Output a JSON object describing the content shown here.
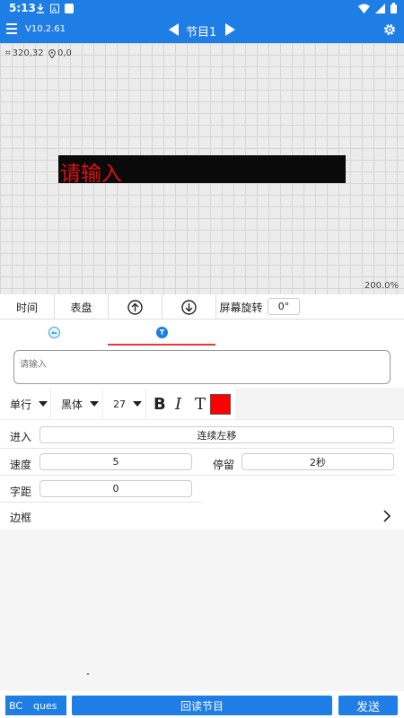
{
  "status_bar": {
    "time": "5:13",
    "icons": [
      "download-icon",
      "notification-icon",
      "app-icon",
      "wifi-icon",
      "signal-icon",
      "battery-icon"
    ]
  },
  "app_bar": {
    "version": "V10.2.61",
    "program": "节目1"
  },
  "canvas": {
    "size_readout": "320,32",
    "position_readout": "0,0",
    "led_text": "请输入",
    "zoom": "200.0%"
  },
  "tools": {
    "time": "时间",
    "dial": "表盘",
    "rotation_label": "屏幕旋转",
    "rotation_value": "0°"
  },
  "text_input": {
    "placeholder": "请输入"
  },
  "font_row": {
    "line_mode": "单行",
    "font": "黑体",
    "size": "27",
    "bold": "B",
    "italic": "I",
    "text_tool": "T",
    "text_color": "#ff0000"
  },
  "form": {
    "enter_label": "进入",
    "enter_value": "连续左移",
    "speed_label": "速度",
    "speed_value": "5",
    "stay_label": "停留",
    "stay_value": "2秒",
    "spacing_label": "字距",
    "spacing_value": "0",
    "border_label": "边框"
  },
  "bottom": {
    "field_left": "BC",
    "field_right": "ques",
    "readback": "回读节目",
    "send": "发送"
  },
  "colors": {
    "accent": "#1f7de6",
    "tab_indicator": "#e03a3a"
  }
}
